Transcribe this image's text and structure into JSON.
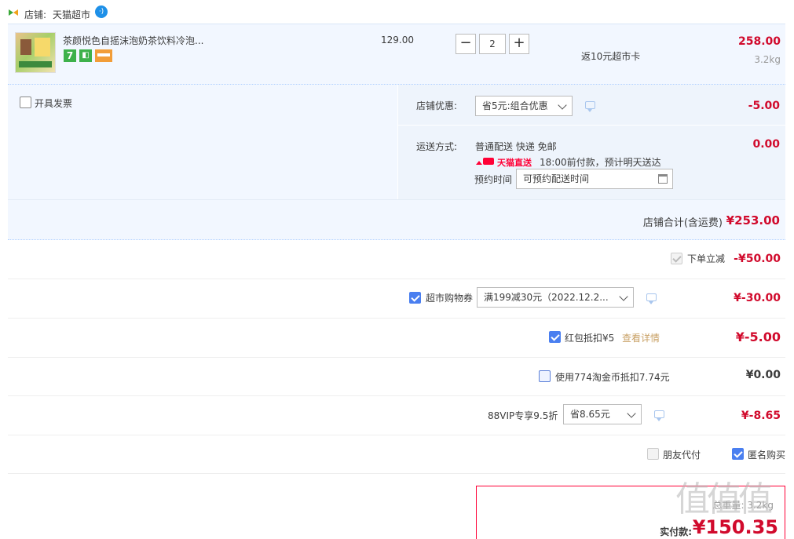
{
  "shop": {
    "label": "店铺:",
    "name": "天猫超市"
  },
  "item": {
    "title": "茶颜悦色自摇沫泡奶茶饮料冷泡...",
    "unit_price": "129.00",
    "quantity": "2",
    "total": "258.00",
    "promo": "返10元超市卡",
    "weight": "3.2kg"
  },
  "invoice": {
    "label": "开具发票"
  },
  "shop_discount": {
    "label": "店铺优惠:",
    "selected": "省5元:组合优惠",
    "amount": "-5.00"
  },
  "shipping": {
    "label": "运送方式:",
    "method": "普通配送 快递 免邮",
    "amount": "0.00",
    "brand": "天猫直送",
    "eta": "18:00前付款，预计明天送达",
    "appointment_label": "预约时间",
    "appointment_placeholder": "可预约配送时间"
  },
  "shop_total": {
    "label": "店铺合计(含运费)",
    "amount": "¥253.00"
  },
  "order_discount": {
    "label": "下单立减",
    "amount": "-¥50.00"
  },
  "coupon": {
    "label": "超市购物券",
    "selected": "满199减30元（2022.12.2...",
    "amount": "¥-30.00"
  },
  "red_packet": {
    "label": "红包抵扣¥5",
    "link": "查看详情",
    "amount": "¥-5.00"
  },
  "tao_coin": {
    "label": "使用774淘金币抵扣7.74元",
    "amount": "¥0.00"
  },
  "vip": {
    "label": "88VIP专享9.5折",
    "selected": "省8.65元",
    "amount": "¥-8.65"
  },
  "friend_pay": {
    "label": "朋友代付"
  },
  "anonymous": {
    "label": "匿名购买"
  },
  "summary": {
    "weight_partial": "总重量: 3.2kg",
    "pay_label": "实付款:",
    "pay_amount": "¥150.35"
  },
  "watermark": "值值值",
  "colors": {
    "accent_red": "#d10a2c",
    "blue_bg": "#f2f7ff",
    "checkbox_blue": "#4a7ff0"
  }
}
